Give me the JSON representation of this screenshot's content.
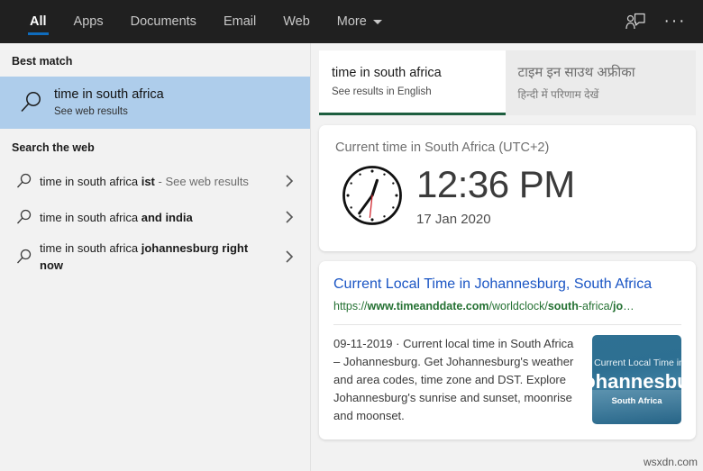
{
  "header": {
    "tabs": [
      {
        "label": "All",
        "active": true
      },
      {
        "label": "Apps",
        "active": false
      },
      {
        "label": "Documents",
        "active": false
      },
      {
        "label": "Email",
        "active": false
      },
      {
        "label": "Web",
        "active": false
      },
      {
        "label": "More",
        "active": false
      }
    ],
    "accent_color": "#0f6cbd",
    "background_color": "#202020",
    "feedback_icon": "person-feedback-icon",
    "overflow_icon": "ellipsis-icon",
    "overflow_glyph": "···"
  },
  "sidebar": {
    "best_match_heading": "Best match",
    "best_match": {
      "icon": "search-icon",
      "title": "time in south africa",
      "subtitle": "See web results",
      "highlight_color": "#aecdeb"
    },
    "search_web_heading": "Search the web",
    "suggestions": [
      {
        "icon": "search-icon",
        "prefix": "time in south africa ",
        "bold": "ist",
        "suffix": " - See web results",
        "chevron": "chevron-right-icon"
      },
      {
        "icon": "search-icon",
        "prefix": "time in south africa ",
        "bold": "and india",
        "suffix": "",
        "chevron": "chevron-right-icon"
      },
      {
        "icon": "search-icon",
        "prefix": "time in south africa ",
        "bold": "johannesburg right now",
        "suffix": "",
        "chevron": "chevron-right-icon"
      }
    ]
  },
  "main": {
    "language_tabs": [
      {
        "title": "time in south africa",
        "subtitle": "See results in English",
        "active": true,
        "underline_color": "#1d5e3f"
      },
      {
        "title": "टाइम इन साउथ अफ्रीका",
        "subtitle": "हिन्दी में परिणाम देखें",
        "active": false,
        "underline_color": ""
      }
    ],
    "time_card": {
      "title": "Current time in South Africa (UTC+2)",
      "time": "12:36 PM",
      "date": "17 Jan 2020",
      "clock_icon": "analog-clock-icon",
      "clock_hour_angle": 18,
      "clock_minute_angle": 216,
      "clock_second_angle": 186,
      "second_hand_color": "#d0242c"
    },
    "web_result": {
      "title": "Current Local Time in Johannesburg, South Africa",
      "url_parts": [
        {
          "text": "https://",
          "bold": false
        },
        {
          "text": "www.timeanddate.com",
          "bold": true
        },
        {
          "text": "/worldclock/",
          "bold": false
        },
        {
          "text": "south",
          "bold": true
        },
        {
          "text": "-africa/",
          "bold": false
        },
        {
          "text": "jo",
          "bold": true
        },
        {
          "text": "…",
          "bold": false
        }
      ],
      "url_plain": "https://www.timeanddate.com/worldclock/south-africa/jo…",
      "snippet": "09-11-2019 · Current local time in South Africa – Johannesburg. Get Johannesburg's weather and area codes, time zone and DST. Explore Johannesburg's sunrise and sunset, moonrise and moonset.",
      "thumbnail": {
        "line1": "Current Local Time in",
        "line2": "Johannesburg",
        "line3": "South Africa"
      }
    }
  },
  "watermark": "wsxdn.com"
}
